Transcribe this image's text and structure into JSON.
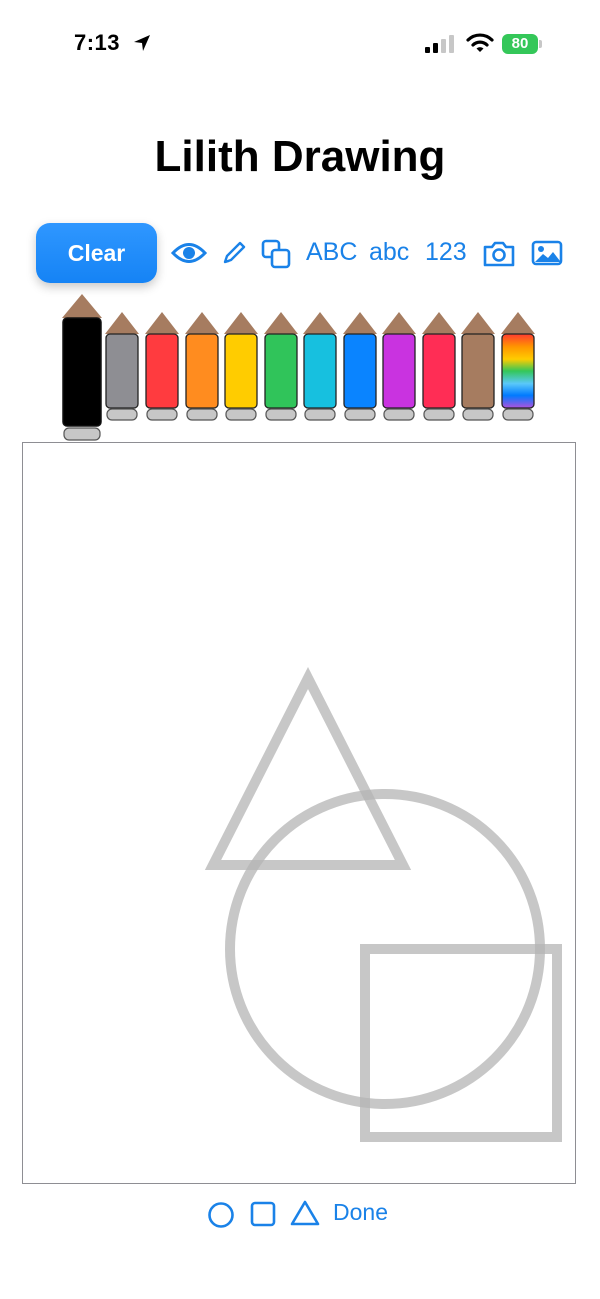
{
  "status_bar": {
    "time": "7:13",
    "battery": "80"
  },
  "page_title": "Lilith Drawing",
  "toolbar": {
    "clear_label": "Clear",
    "upper_label": "ABC",
    "lower_label": "abc",
    "numbers_label": "123",
    "icons": [
      "eye-icon",
      "pencil-icon",
      "copy-icon",
      "camera-icon",
      "photo-icon"
    ]
  },
  "colors": {
    "accent": "#1a82e8",
    "wood": "#a67c60",
    "pencils": [
      "#000000",
      "#8e8e93",
      "#ff3b3f",
      "#ff8c1f",
      "#ffcc00",
      "#30c45a",
      "#17c0df",
      "#0a84ff",
      "#c933e0",
      "#ff2d55",
      "#a67c60",
      "rainbow"
    ],
    "selected_index": 0,
    "shape_stroke": "#c8c8c8"
  },
  "bottom_bar": {
    "done_label": "Done",
    "icons": [
      "circle-icon",
      "square-icon",
      "triangle-icon"
    ]
  }
}
